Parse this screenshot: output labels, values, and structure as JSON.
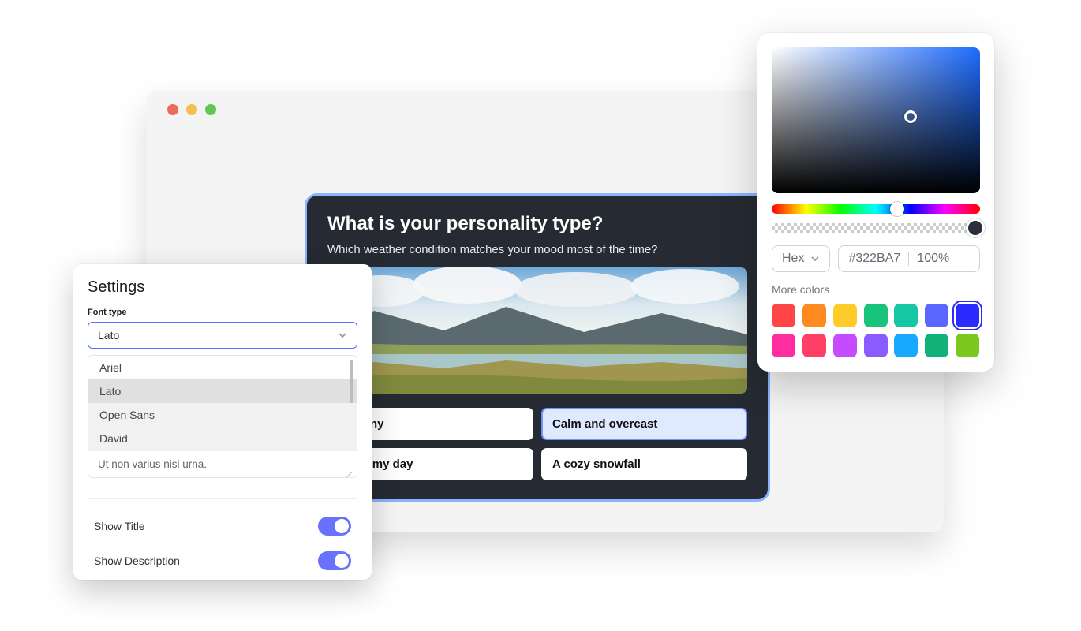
{
  "quiz": {
    "title": "What is your personality type?",
    "subtitle": "Which weather condition matches your mood most of the time?",
    "options": [
      {
        "label": "d sunny",
        "selected": false
      },
      {
        "label": "Calm and overcast",
        "selected": true
      },
      {
        "label": "A stormy day",
        "selected": false
      },
      {
        "label": "A cozy snowfall",
        "selected": false
      }
    ]
  },
  "settings": {
    "title": "Settings",
    "font_label": "Font type",
    "font_selected": "Lato",
    "font_options": [
      "Ariel",
      "Lato",
      "Open Sans",
      "David"
    ],
    "text_value": "Ut non varius nisi urna.",
    "toggles": {
      "show_title": {
        "label": "Show Title",
        "on": true
      },
      "show_description": {
        "label": "Show Description",
        "on": true
      }
    }
  },
  "picker": {
    "mode": "Hex",
    "hex": "#322BA7",
    "alpha": "100%",
    "more_label": "More colors",
    "swatches_row1": [
      "#ff4545",
      "#ff8a1f",
      "#ffcb2b",
      "#18c47b",
      "#15c7a3",
      "#5966ff",
      "#2c2bff"
    ],
    "swatches_row2": [
      "#ff2da0",
      "#ff3f66",
      "#c44bff",
      "#8a5cff",
      "#16a9ff",
      "#11b17a",
      "#7bc91e"
    ],
    "selected_swatch": 6
  }
}
